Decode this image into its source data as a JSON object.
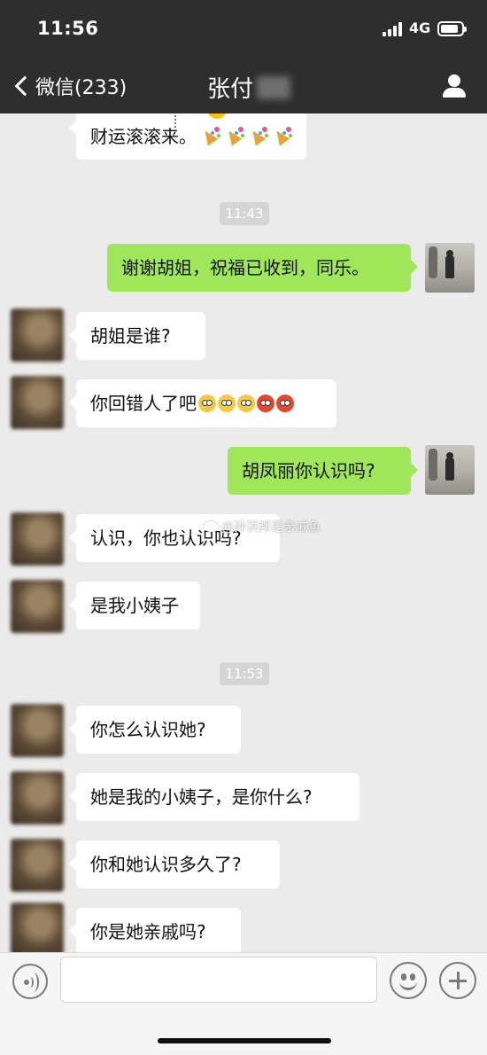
{
  "status_bar": {
    "time": "11:56",
    "network": "4G",
    "battery_level": 0.85
  },
  "nav": {
    "back_label": "微信(233)",
    "title": "张付"
  },
  "chat": {
    "top_message": {
      "text": "财运滚滚来。"
    },
    "timestamps": [
      "11:43",
      "11:53"
    ],
    "messages": [
      {
        "side": "right",
        "text": "谢谢胡姐，祝福已收到，同乐。"
      },
      {
        "side": "left",
        "text": "胡姐是谁?"
      },
      {
        "side": "left",
        "text": "你回错人了吧",
        "emojis": [
          "flushed",
          "flushed",
          "flushed",
          "angry",
          "angry"
        ]
      },
      {
        "side": "right",
        "text": "胡凤丽你认识吗?"
      },
      {
        "side": "left",
        "text": "认识，你也认识吗?"
      },
      {
        "side": "left",
        "text": "是我小姨子"
      },
      {
        "side": "left",
        "text": "你怎么认识她?"
      },
      {
        "side": "left",
        "text": "她是我的小姨子，是你什么?"
      },
      {
        "side": "left",
        "text": "你和她认识多久了?"
      },
      {
        "side": "left",
        "text": "你是她亲戚吗?"
      }
    ],
    "watermark": "@孙洪邦是亲戚鱼"
  },
  "input_bar": {
    "placeholder": ""
  },
  "icons": [
    "back-icon",
    "person-icon",
    "voice-icon",
    "emoji-face-icon",
    "plus-icon",
    "weibo-icon"
  ]
}
